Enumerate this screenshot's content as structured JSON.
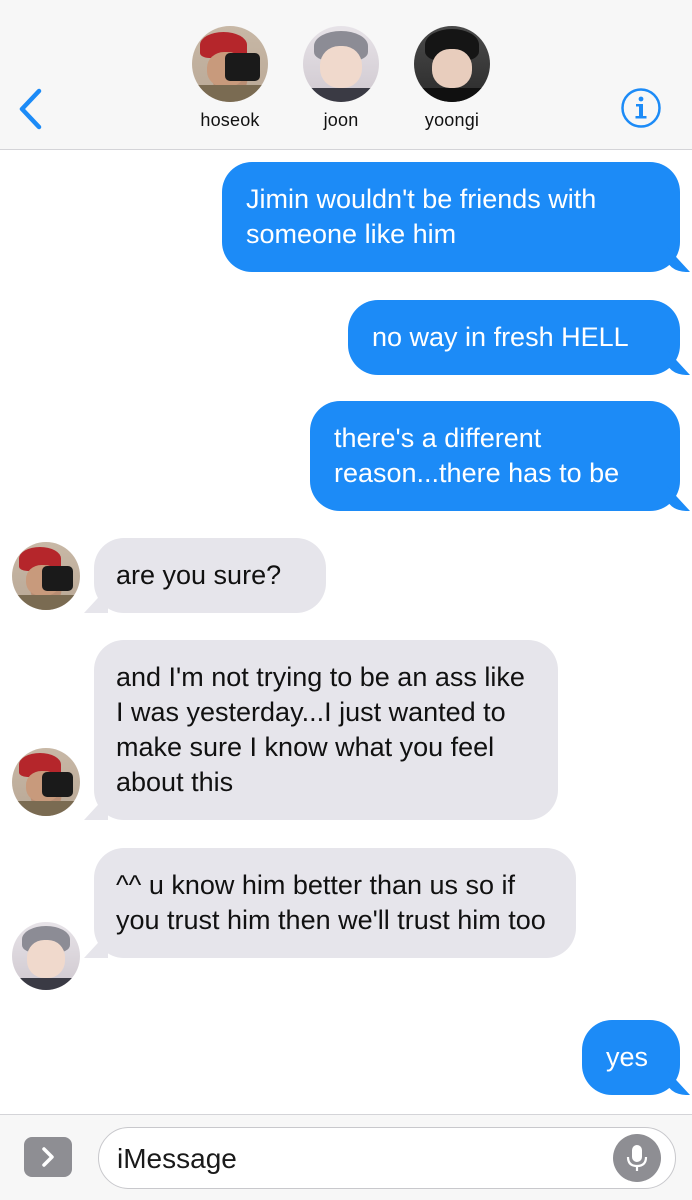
{
  "header": {
    "participants": [
      {
        "name": "hoseok"
      },
      {
        "name": "joon"
      },
      {
        "name": "yoongi"
      }
    ],
    "back_icon": "chevron-left-icon",
    "info_icon": "info-icon",
    "accent_color": "#1c8bf7"
  },
  "messages": [
    {
      "direction": "outgoing",
      "text": "Jimin wouldn't be friends with someone like him"
    },
    {
      "direction": "outgoing",
      "text": "no way in fresh HELL"
    },
    {
      "direction": "outgoing",
      "text": "there's a different reason...there has to be"
    },
    {
      "direction": "incoming",
      "sender": "hoseok",
      "text": "are you sure?"
    },
    {
      "direction": "incoming",
      "sender": "hoseok",
      "text": "and I'm not trying to be an ass like I was yesterday...I just wanted to make sure I know what you feel about this"
    },
    {
      "direction": "incoming",
      "sender": "joon",
      "text": "^^ u know him better than us so if you trust him then we'll trust him too"
    },
    {
      "direction": "outgoing",
      "text": "yes"
    }
  ],
  "composer": {
    "placeholder": "iMessage",
    "expand_icon": "chevron-right-icon",
    "mic_icon": "microphone-icon"
  },
  "colors": {
    "outgoing_bubble": "#1c8bf7",
    "incoming_bubble": "#e6e5eb",
    "header_background": "#f7f7f7"
  }
}
